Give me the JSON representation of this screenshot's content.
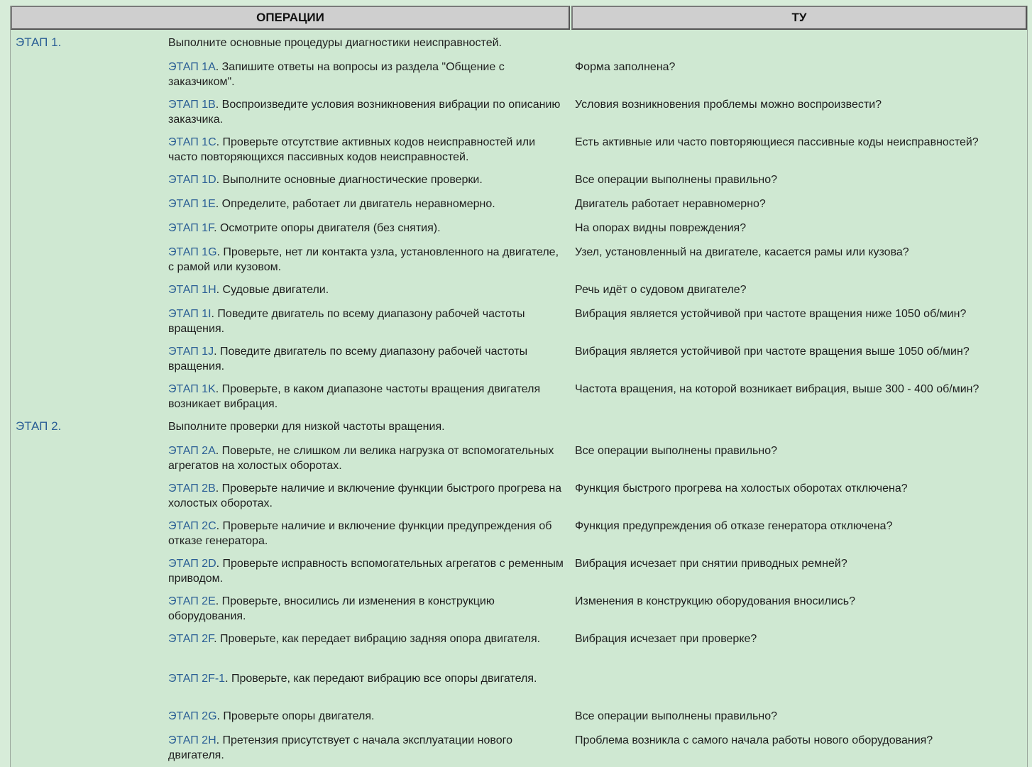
{
  "header": {
    "operations": "ОПЕРАЦИИ",
    "tu": "ТУ"
  },
  "rows": [
    {
      "stage": "ЭТАП 1.",
      "step": "",
      "op": "Выполните основные процедуры диагностики неисправностей.",
      "tu": ""
    },
    {
      "stage": "",
      "step": "ЭТАП 1A",
      "op": ". Запишите ответы на вопросы из раздела \"Общение с заказчиком\".",
      "tu": "Форма заполнена?"
    },
    {
      "stage": "",
      "step": "ЭТАП 1B",
      "op": ". Воспроизведите условия возникновения вибрации по описанию заказчика.",
      "tu": "Условия возникновения проблемы можно воспроизвести?"
    },
    {
      "stage": "",
      "step": "ЭТАП 1C",
      "op": ". Проверьте отсутствие активных кодов неисправностей или часто повторяющихся пассивных кодов неисправностей.",
      "tu": "Есть активные или часто повторяющиеся пассивные коды неисправностей?"
    },
    {
      "stage": "",
      "step": "ЭТАП 1D",
      "op": ". Выполните основные диагностические проверки.",
      "tu": "Все операции выполнены правильно?"
    },
    {
      "stage": "",
      "step": "ЭТАП 1E",
      "op": ". Определите, работает ли двигатель неравномерно.",
      "tu": "Двигатель работает неравномерно?"
    },
    {
      "stage": "",
      "step": "ЭТАП 1F",
      "op": ". Осмотрите опоры двигателя (без снятия).",
      "tu": "На опорах видны повреждения?"
    },
    {
      "stage": "",
      "step": "ЭТАП 1G",
      "op": ". Проверьте, нет ли контакта узла, установленного на двигателе, с рамой или кузовом.",
      "tu": "Узел, установленный на двигателе, касается рамы или кузова?"
    },
    {
      "stage": "",
      "step": "ЭТАП 1H",
      "op": ". Судовые двигатели.",
      "tu": "Речь идёт о судовом двигателе?"
    },
    {
      "stage": "",
      "step": "ЭТАП 1I",
      "op": ". Поведите двигатель по всему диапазону рабочей частоты вращения.",
      "tu": "Вибрация является устойчивой при частоте вращения ниже 1050 об/мин?"
    },
    {
      "stage": "",
      "step": "ЭТАП 1J",
      "op": ". Поведите двигатель по всему диапазону рабочей частоты вращения.",
      "tu": "Вибрация является устойчивой при частоте вращения выше 1050 об/мин?"
    },
    {
      "stage": "",
      "step": "ЭТАП 1K",
      "op": ". Проверьте, в каком диапазоне частоты вращения двигателя возникает вибрация.",
      "tu": "Частота вращения, на которой возникает вибрация, выше 300 - 400 об/мин?"
    },
    {
      "stage": "ЭТАП 2.",
      "step": "",
      "op": "Выполните проверки для низкой частоты вращения.",
      "tu": ""
    },
    {
      "stage": "",
      "step": "ЭТАП 2A",
      "op": ". Поверьте, не слишком ли велика нагрузка от вспомогательных агрегатов на холостых оборотах.",
      "tu": "Все операции выполнены правильно?"
    },
    {
      "stage": "",
      "step": "ЭТАП 2B",
      "op": ". Проверьте наличие и включение функции быстрого прогрева на холостых оборотах.",
      "tu": "Функция быстрого прогрева на холостых оборотах отключена?"
    },
    {
      "stage": "",
      "step": "ЭТАП 2C",
      "op": ". Проверьте наличие и включение функции предупреждения об отказе генератора.",
      "tu": "Функция предупреждения об отказе генератора отключена?"
    },
    {
      "stage": "",
      "step": "ЭТАП 2D",
      "op": ". Проверьте исправность вспомогательных агрегатов с ременным приводом.",
      "tu": "Вибрация исчезает при снятии приводных ремней?"
    },
    {
      "stage": "",
      "step": "ЭТАП 2E",
      "op": ". Проверьте, вносились ли изменения в конструкцию оборудования.",
      "tu": "Изменения в конструкцию оборудования вносились?"
    },
    {
      "stage": "",
      "step": "ЭТАП 2F",
      "op": ". Проверьте, как передает вибрацию задняя опора двигателя.",
      "tu": "Вибрация исчезает при проверке?"
    },
    {
      "stage": "",
      "step": "ЭТАП 2F-1",
      "op": ". Проверьте, как передают вибрацию все опоры двигателя.",
      "tu": ""
    },
    {
      "stage": "",
      "step": "ЭТАП 2G",
      "op": ". Проверьте опоры двигателя.",
      "tu": "Все операции выполнены правильно?"
    },
    {
      "stage": "",
      "step": "ЭТАП 2H",
      "op": ". Претензия присутствует с начала эксплуатации нового двигателя.",
      "tu": "Проблема возникла с самого начала работы нового оборудования?"
    }
  ]
}
